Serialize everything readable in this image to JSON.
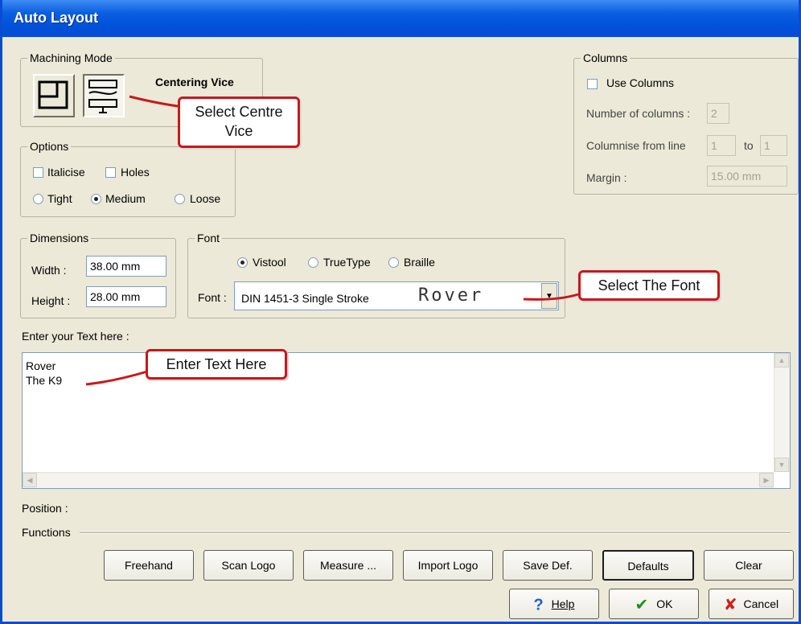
{
  "window": {
    "title": "Auto Layout"
  },
  "machining_mode": {
    "legend": "Machining Mode",
    "mode_label": "Centering Vice"
  },
  "options": {
    "legend": "Options",
    "italicise": "Italicise",
    "holes": "Holes",
    "tight": "Tight",
    "medium": "Medium",
    "loose": "Loose",
    "spacing_selected": "Medium"
  },
  "columns": {
    "legend": "Columns",
    "use_columns": "Use Columns",
    "number_label": "Number of columns :",
    "number_value": "2",
    "columnise_label": "Columnise from line",
    "from_value": "1",
    "to_label": "to",
    "to_value": "1",
    "margin_label": "Margin :",
    "margin_value": "15.00 mm"
  },
  "dimensions": {
    "legend": "Dimensions",
    "width_label": "Width :",
    "width_value": "38.00 mm",
    "height_label": "Height :",
    "height_value": "28.00 mm"
  },
  "font": {
    "legend": "Font",
    "vistool": "Vistool",
    "truetype": "TrueType",
    "braille": "Braille",
    "type_selected": "Vistool",
    "font_label": "Font :",
    "font_value": "DIN 1451-3 Single Stroke",
    "preview": "Rover"
  },
  "text_entry": {
    "label": "Enter your Text here :",
    "lines": [
      "Rover",
      "The K9"
    ]
  },
  "position_label": "Position :",
  "functions": {
    "label": "Functions",
    "buttons": [
      "Freehand",
      "Scan Logo",
      "Measure ...",
      "Import Logo",
      "Save Def.",
      "Defaults",
      "Clear"
    ]
  },
  "dialog_buttons": {
    "help": "Help",
    "ok": "OK",
    "cancel": "Cancel"
  },
  "annotations": {
    "select_vice": "Select Centre Vice",
    "select_font": "Select The Font",
    "enter_text": "Enter Text Here"
  },
  "colors": {
    "titlebar": "#0a5fe0",
    "callout_border": "#c8181c",
    "dialog_bg": "#ece9d8"
  },
  "icons": [
    "clamp-mode-icon",
    "centering-vice-icon",
    "help-icon",
    "ok-checkmark-icon",
    "cancel-x-icon"
  ]
}
